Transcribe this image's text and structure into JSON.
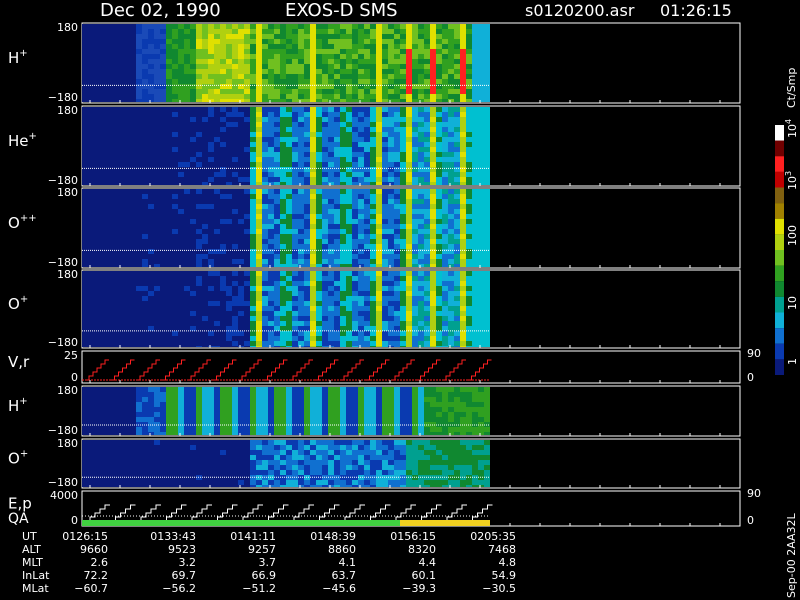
{
  "header": {
    "date": "Dec 02, 1990",
    "instrument": "EXOS-D SMS",
    "filename": "s0120200.asr",
    "time": "01:26:15"
  },
  "chart_data": {
    "type": "heatmap",
    "panels": [
      {
        "id": "h-plus",
        "label": "H",
        "sup": "+",
        "ytop": "180",
        "ybot": "−180",
        "profile": "hp"
      },
      {
        "id": "he-plus",
        "label": "He",
        "sup": "+",
        "ytop": "180",
        "ybot": "−180",
        "profile": "he"
      },
      {
        "id": "o-plus-plus",
        "label": "O",
        "sup": "++",
        "ytop": "180",
        "ybot": "−180",
        "profile": "opp"
      },
      {
        "id": "o-plus",
        "label": "O",
        "sup": "+",
        "ytop": "180",
        "ybot": "−180",
        "profile": "op"
      },
      {
        "id": "v-r",
        "label": "V,r",
        "sup": "",
        "ytop": "25",
        "ybot": "0",
        "profile": "line",
        "rtop": "90",
        "rbot": "0"
      },
      {
        "id": "h-plus-2",
        "label": "H",
        "sup": "+",
        "ytop": "180",
        "ybot": "−180",
        "profile": "hp2"
      },
      {
        "id": "o-plus-2",
        "label": "O",
        "sup": "+",
        "ytop": "180",
        "ybot": "−180",
        "profile": "op2"
      },
      {
        "id": "e-p",
        "label": "E,p",
        "sup": "",
        "ytop": "4000",
        "ybot": "0",
        "profile": "step",
        "rtop": "90",
        "rbot": "0"
      }
    ],
    "qa_label": "QA",
    "colorbar": {
      "title": "Ct/Smp",
      "tick_labels": [
        "1",
        "10",
        "100",
        "10",
        "10"
      ],
      "tick_exponents": [
        "",
        "",
        "",
        "3",
        "4"
      ],
      "colors": [
        "#0a1a7a",
        "#0a3ab0",
        "#1070d0",
        "#10b0d8",
        "#00a090",
        "#108830",
        "#30a020",
        "#70c020",
        "#b0d010",
        "#e0e000",
        "#a08000",
        "#806010",
        "#c00000",
        "#ff2020",
        "#700000",
        "#ffffff"
      ]
    },
    "ephemeris": {
      "rows": [
        {
          "label": "UT",
          "values": [
            "0126:15",
            "0133:43",
            "0141:11",
            "0148:39",
            "0156:15",
            "0205:35"
          ]
        },
        {
          "label": "ALT",
          "values": [
            "9660",
            "9523",
            "9257",
            "8860",
            "8320",
            "7468"
          ]
        },
        {
          "label": "MLT",
          "values": [
            "2.6",
            "3.2",
            "3.7",
            "4.1",
            "4.4",
            "4.8"
          ]
        },
        {
          "label": "InLat",
          "values": [
            "72.2",
            "69.7",
            "66.9",
            "63.7",
            "60.1",
            "54.9"
          ]
        },
        {
          "label": "MLat",
          "values": [
            "−60.7",
            "−56.2",
            "−51.2",
            "−45.6",
            "−39.3",
            "−30.5"
          ]
        }
      ]
    },
    "side_stamp": "Sep-00  2AA32L"
  }
}
